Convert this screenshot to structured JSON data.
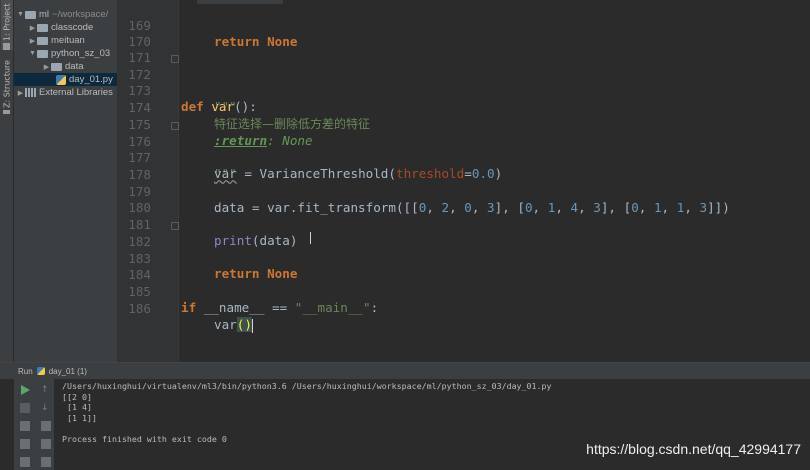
{
  "tool_strip": {
    "project_tab": "1: Project",
    "structure_tab": "Z: Structure"
  },
  "project_tree": [
    {
      "label": "ml",
      "suffix": "~/workspace/",
      "type": "folder",
      "expanded": true,
      "depth": 0
    },
    {
      "label": "classcode",
      "type": "folder",
      "expanded": false,
      "depth": 1
    },
    {
      "label": "meituan",
      "type": "folder",
      "expanded": false,
      "depth": 1
    },
    {
      "label": "python_sz_03",
      "type": "folder",
      "expanded": true,
      "depth": 1
    },
    {
      "label": "data",
      "type": "folder",
      "expanded": false,
      "depth": 2
    },
    {
      "label": "day_01.py",
      "type": "python-file",
      "selected": true,
      "depth": 2
    },
    {
      "label": "External Libraries",
      "type": "library",
      "expanded": false,
      "depth": 0
    }
  ],
  "editor": {
    "tab": "day_01.py",
    "lines": [
      {
        "n": "169",
        "text": "return None"
      },
      {
        "n": "170",
        "text": ""
      },
      {
        "n": "171",
        "text": ""
      },
      {
        "n": "172",
        "kw": "def ",
        "fn": "var",
        "rest": "():"
      },
      {
        "n": "173",
        "text": "\"\"\""
      },
      {
        "n": "174",
        "text": "特征选择—删除低方差的特征"
      },
      {
        "n": "175",
        "tag": ":return",
        "text": ": None"
      },
      {
        "n": "176",
        "text": "\"\"\""
      },
      {
        "n": "177",
        "var": "var",
        "a": " = VarianceThreshold(",
        "param": "threshold",
        "b": "=",
        "num": "0.0",
        "c": ")"
      },
      {
        "n": "178",
        "text": ""
      },
      {
        "n": "179",
        "text": "data = var.fit_transform([[0, 2, 0, 3], [0, 1, 4, 3], [0, 1, 1, 3]])"
      },
      {
        "n": "180",
        "text": ""
      },
      {
        "n": "181",
        "text": "print(data)"
      },
      {
        "n": "182",
        "kw": "return ",
        "rest": "None"
      },
      {
        "n": "183",
        "text": ""
      },
      {
        "n": "184",
        "text": ""
      },
      {
        "n": "185",
        "kw": "if ",
        "a": "__name__",
        "b": " == ",
        "str": "\"__main__\"",
        "c": ":"
      },
      {
        "n": "186",
        "text": "var()"
      }
    ]
  },
  "run_panel": {
    "label": "Run",
    "config": "day_01 (1)",
    "console": [
      "/Users/huxinghui/virtualenv/ml3/bin/python3.6 /Users/huxinghui/workspace/ml/python_sz_03/day_01.py",
      "[[2 0]",
      " [1 4]",
      " [1 1]]",
      "",
      "Process finished with exit code 0"
    ]
  },
  "watermark": "https://blog.csdn.net/qq_42994177"
}
